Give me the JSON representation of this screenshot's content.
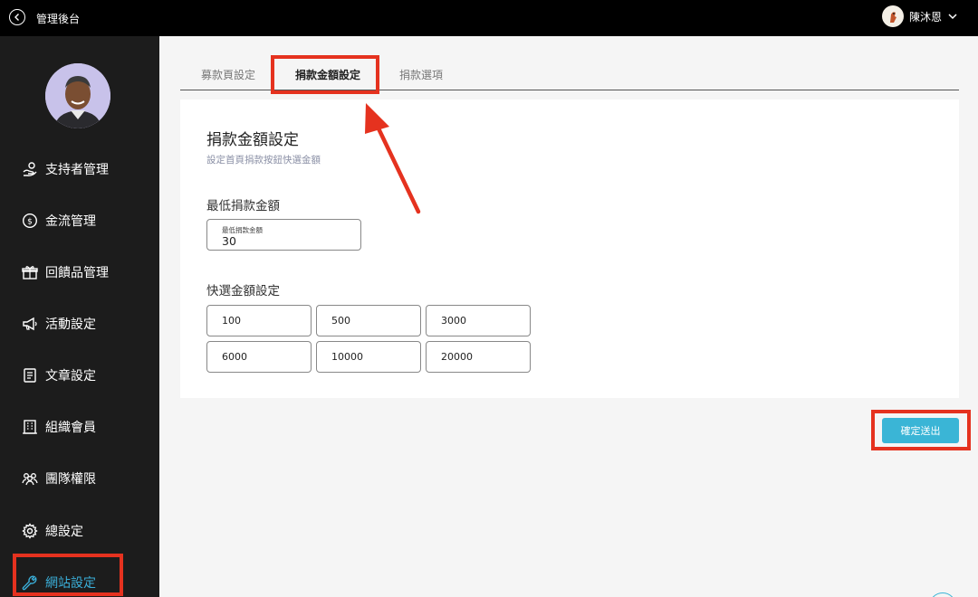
{
  "topbar": {
    "title": "管理後台",
    "user_name": "陳沐恩"
  },
  "sidebar": {
    "items": [
      {
        "label": "支持者管理",
        "icon": "supporter-icon"
      },
      {
        "label": "金流管理",
        "icon": "dollar-icon"
      },
      {
        "label": "回饋品管理",
        "icon": "gift-icon"
      },
      {
        "label": "活動設定",
        "icon": "megaphone-icon"
      },
      {
        "label": "文章設定",
        "icon": "document-icon"
      },
      {
        "label": "組織會員",
        "icon": "building-icon"
      },
      {
        "label": "團隊權限",
        "icon": "team-icon"
      },
      {
        "label": "總設定",
        "icon": "gear-icon"
      },
      {
        "label": "網站設定",
        "icon": "wrench-icon",
        "active": true
      }
    ]
  },
  "tabs": [
    {
      "label": "募款頁設定",
      "active": false
    },
    {
      "label": "捐款金額設定",
      "active": true
    },
    {
      "label": "捐款選項",
      "active": false
    }
  ],
  "card": {
    "title": "捐款金額設定",
    "subtitle": "設定首頁捐款按鈕快選金額",
    "min_section_label": "最低捐款金額",
    "min_field": {
      "label": "最低捐款金額",
      "value": "30"
    },
    "quick_section_label": "快選金額設定",
    "quick_amounts": [
      "100",
      "500",
      "3000",
      "6000",
      "10000",
      "20000"
    ]
  },
  "submit_label": "確定送出",
  "colors": {
    "accent": "#3ab5d6",
    "active_nav": "#3aaed8",
    "annotation": "#e5321f",
    "sidebar_bg": "#1c1c1c",
    "topbar_bg": "#000000"
  }
}
